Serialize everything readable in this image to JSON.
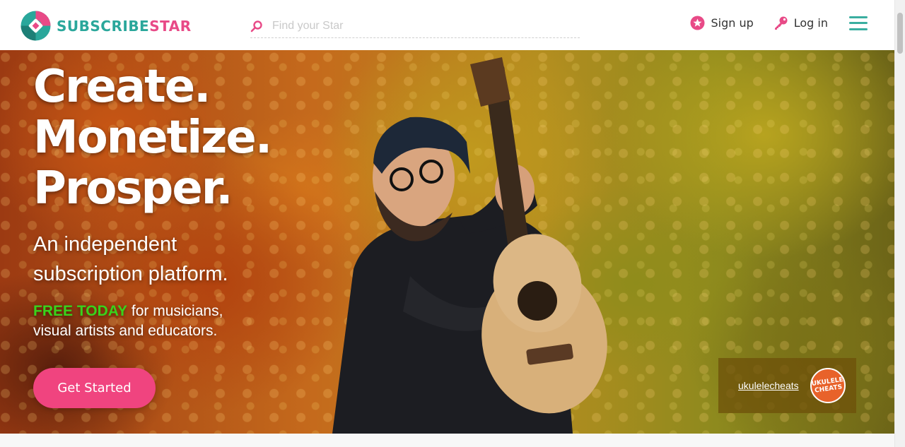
{
  "header": {
    "logo": {
      "sub": "SUBSCRIBE",
      "star": "STAR"
    },
    "search": {
      "placeholder": "Find your Star"
    },
    "nav": {
      "signup_label": "Sign up",
      "login_label": "Log in"
    }
  },
  "hero": {
    "headline": [
      "Create.",
      "Monetize.",
      "Prosper."
    ],
    "subhead": [
      "An independent",
      "subscription platform."
    ],
    "tag": {
      "free": "FREE TODAY",
      "rest1": " for musicians,",
      "rest2": "visual artists and educators."
    },
    "cta_label": "Get Started",
    "creator": {
      "name": "ukulelecheats",
      "avatar_text": "UKULELE CHEATS"
    }
  },
  "colors": {
    "brand_teal": "#2aa79b",
    "brand_pink": "#e84a87",
    "cta": "#f0447f",
    "free": "#38d31c"
  },
  "icons": [
    "logo-mark-icon",
    "search-icon",
    "star-badge-icon",
    "key-icon",
    "menu-icon"
  ]
}
